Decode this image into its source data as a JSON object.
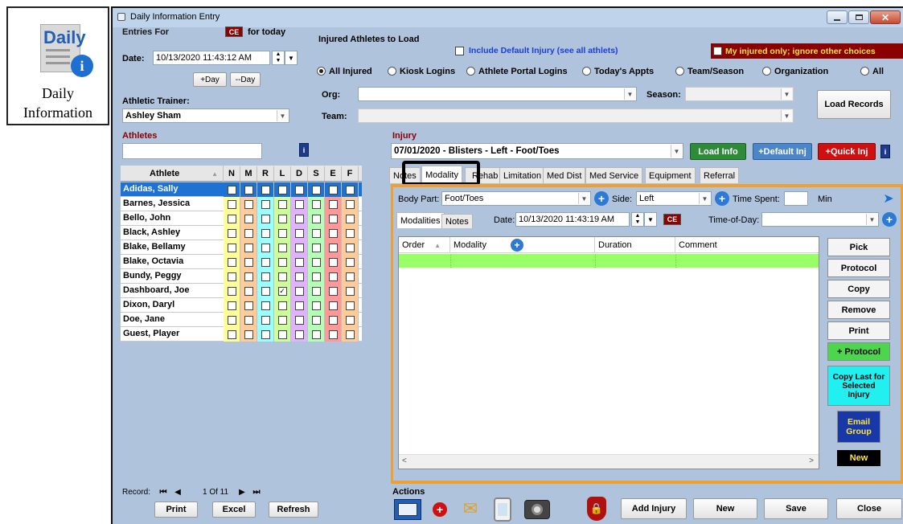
{
  "desktop_icon": {
    "logo_text": "Daily",
    "label_line1": "Daily",
    "label_line2": "Information"
  },
  "window": {
    "title": "Daily Information Entry",
    "buttons": [
      "minimize",
      "maximize",
      "close"
    ]
  },
  "entries": {
    "label": "Entries For",
    "ce_badge": "CE",
    "for_today": "for today",
    "date_label": "Date:",
    "date_value": "10/13/2020 11:43:12 AM",
    "plus_day": "+Day",
    "minus_day": "--Day",
    "trainer_label": "Athletic Trainer:",
    "trainer_value": "Ashley Sham"
  },
  "injured_load": {
    "title": "Injured Athletes to Load",
    "include_default": "Include Default Injury (see all athlets)",
    "my_injured_only": "My injured only; ignore other choices",
    "radios": [
      "All Injured",
      "Kiosk Logins",
      "Athlete Portal Logins",
      "Today's Appts",
      "Team/Season",
      "Organization",
      "All"
    ],
    "selected_radio": "All Injured",
    "org_label": "Org:",
    "season_label": "Season:",
    "team_label": "Team:",
    "load_records": "Load Records"
  },
  "athletes": {
    "title": "Athletes",
    "search_value": "",
    "columns": [
      "Athlete",
      "N",
      "M",
      "R",
      "L",
      "D",
      "S",
      "E",
      "F"
    ],
    "rows": [
      {
        "name": "Adidas, Sally",
        "checked": [
          false,
          false,
          false,
          false,
          false,
          false,
          false,
          false
        ],
        "selected": true
      },
      {
        "name": "Barnes, Jessica",
        "checked": [
          false,
          false,
          false,
          false,
          false,
          false,
          false,
          false
        ]
      },
      {
        "name": "Bello, John",
        "checked": [
          false,
          false,
          false,
          false,
          false,
          false,
          false,
          false
        ]
      },
      {
        "name": "Black, Ashley",
        "checked": [
          false,
          false,
          false,
          false,
          false,
          false,
          false,
          false
        ]
      },
      {
        "name": "Blake, Bellamy",
        "checked": [
          false,
          false,
          false,
          false,
          false,
          false,
          false,
          false
        ]
      },
      {
        "name": "Blake, Octavia",
        "checked": [
          false,
          false,
          false,
          false,
          false,
          false,
          false,
          false
        ]
      },
      {
        "name": "Bundy, Peggy",
        "checked": [
          false,
          false,
          false,
          false,
          false,
          false,
          false,
          false
        ]
      },
      {
        "name": "Dashboard, Joe",
        "checked": [
          false,
          false,
          false,
          true,
          false,
          false,
          false,
          false
        ]
      },
      {
        "name": "Dixon, Daryl",
        "checked": [
          false,
          false,
          false,
          false,
          false,
          false,
          false,
          false
        ]
      },
      {
        "name": "Doe, Jane",
        "checked": [
          false,
          false,
          false,
          false,
          false,
          false,
          false,
          false
        ]
      },
      {
        "name": "Guest, Player",
        "checked": [
          false,
          false,
          false,
          false,
          false,
          false,
          false,
          false
        ]
      }
    ],
    "column_colors": [
      "#ffff99",
      "#ffcc99",
      "#99ffff",
      "#ccff99",
      "#e0b3ff",
      "#b3ffb3",
      "#ff9999",
      "#ffcc99"
    ],
    "record_label": "Record:",
    "record_position": "1 Of  11",
    "print": "Print",
    "excel": "Excel",
    "refresh": "Refresh"
  },
  "injury": {
    "title": "Injury",
    "selected": "07/01/2020 - Blisters - Left - Foot/Toes",
    "load_info": "Load Info",
    "default_inj": "+Default Inj",
    "quick_inj": "+Quick Inj",
    "tabs": [
      "Notes",
      "Modality",
      "Rehab",
      "Limitation",
      "Med Dist",
      "Med Service",
      "Equipment",
      "Referral"
    ],
    "active_tab": "Modality",
    "body_part_label": "Body Part:",
    "body_part_value": "Foot/Toes",
    "side_label": "Side:",
    "side_value": "Left",
    "time_spent_label": "Time Spent:",
    "time_spent_value": "",
    "min_label": "Min",
    "sub_tabs": [
      "Modalities",
      "Notes"
    ],
    "date_label": "Date:",
    "date_value": "10/13/2020 11:43:19 AM",
    "ce_badge": "CE",
    "time_of_day_label": "Time-of-Day:",
    "time_of_day_value": "",
    "grid_columns": [
      "Order",
      "Modality",
      "Duration",
      "Comment"
    ]
  },
  "side_buttons": [
    "Pick",
    "Protocol",
    "Copy",
    "Remove",
    "Print",
    "+ Protocol",
    "Copy Last for Selected Injury",
    "Email Group",
    "New"
  ],
  "actions": {
    "title": "Actions",
    "add_injury": "Add Injury",
    "new": "New",
    "save": "Save",
    "close": "Close"
  },
  "colors": {
    "panel": "#afc3dd",
    "title_red": "#8b0000",
    "selected_row": "#1e73d2",
    "grid_green": "#99ff66",
    "load_info_green": "#2e8b3a",
    "quick_inj_red": "#d01010",
    "default_inj_blue": "#4a86c8",
    "accent_orange": "#f0a030"
  }
}
